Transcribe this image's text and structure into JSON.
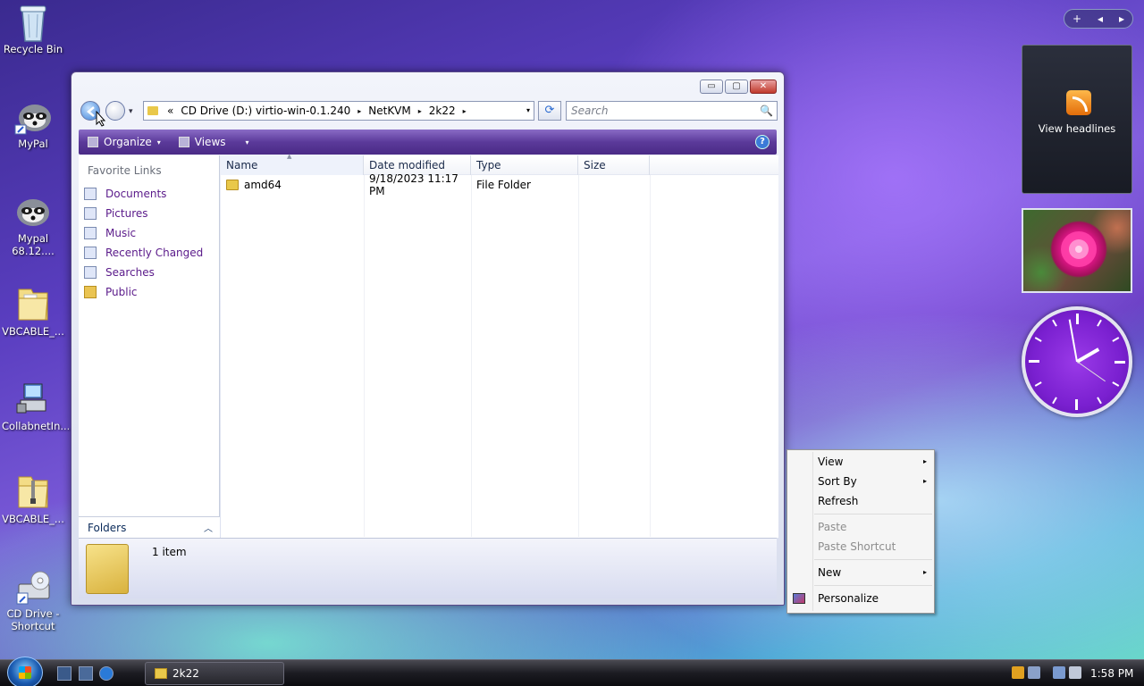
{
  "desktop": {
    "icons": [
      {
        "label": "Recycle Bin"
      },
      {
        "label": "MyPal"
      },
      {
        "label": "Mypal 68.12...."
      },
      {
        "label": "VBCABLE_..."
      },
      {
        "label": "CollabnetIn..."
      },
      {
        "label": "VBCABLE_..."
      },
      {
        "label": "CD Drive - Shortcut"
      }
    ]
  },
  "explorer": {
    "address": {
      "overflow": "«",
      "crumbs": [
        "CD Drive (D:) virtio-win-0.1.240",
        "NetKVM",
        "2k22"
      ],
      "separator": "▸",
      "dropdown": "▾"
    },
    "search": {
      "placeholder": "Search",
      "icon": "🔍"
    },
    "nav_dropdown": "▾",
    "refresh_glyph": "⟳",
    "window_controls": {
      "minimize": "▭",
      "maximize": "▢",
      "close": "✕"
    },
    "toolbar": {
      "organize": "Organize",
      "views": "Views",
      "caret": "▾",
      "help": "?"
    },
    "favorite_links": {
      "header": "Favorite Links",
      "items": [
        {
          "label": "Documents"
        },
        {
          "label": "Pictures"
        },
        {
          "label": "Music"
        },
        {
          "label": "Recently Changed"
        },
        {
          "label": "Searches"
        },
        {
          "label": "Public"
        }
      ]
    },
    "folders_bar": {
      "label": "Folders",
      "chevron": "︿"
    },
    "columns": {
      "name": "Name",
      "date": "Date modified",
      "type": "Type",
      "size": "Size",
      "sort_glyph": "▲"
    },
    "rows": [
      {
        "name": "amd64",
        "date": "9/18/2023 11:17 PM",
        "type": "File Folder",
        "size": ""
      }
    ],
    "details": {
      "count": "1 item"
    }
  },
  "context_menu": {
    "items": [
      {
        "label": "View",
        "submenu": "▸"
      },
      {
        "label": "Sort By",
        "submenu": "▸"
      },
      {
        "label": "Refresh"
      },
      {
        "label": "Paste"
      },
      {
        "label": "Paste Shortcut"
      },
      {
        "label": "New",
        "submenu": "▸"
      },
      {
        "label": "Personalize"
      }
    ]
  },
  "sidebar": {
    "controls": {
      "add": "+",
      "prev": "◂",
      "next": "▸"
    },
    "feed": {
      "label": "View headlines"
    }
  },
  "taskbar": {
    "window_button": "2k22",
    "clock": "1:58 PM"
  },
  "colors": {
    "toolbar": "#5b3a9a",
    "link": "#5a1a8a",
    "clock_face": "#7a20d0",
    "feed_icon": "#e36d0a"
  }
}
